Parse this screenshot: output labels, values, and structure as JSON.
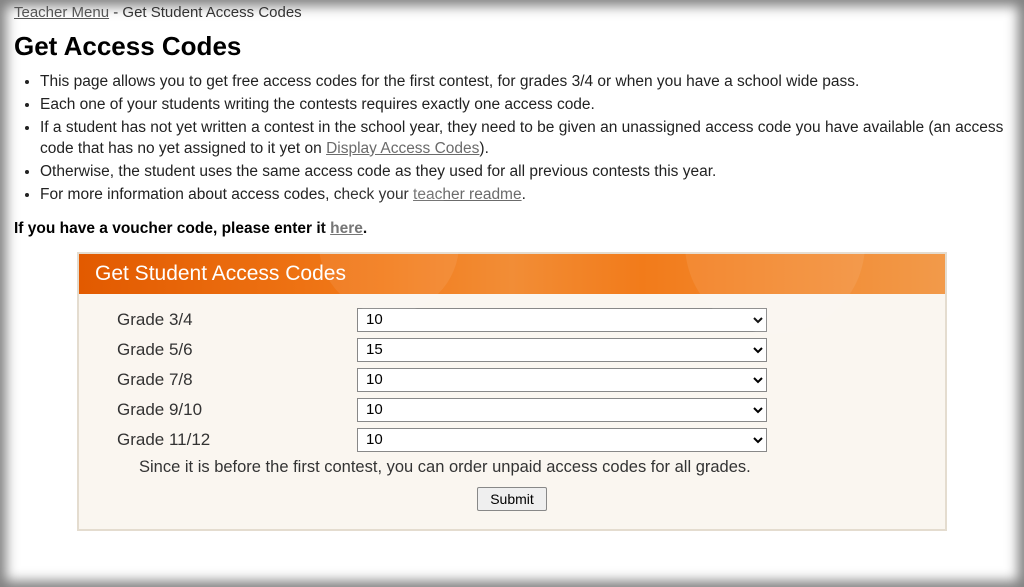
{
  "breadcrumb": {
    "link": "Teacher Menu",
    "separator": " - ",
    "current": "Get Student Access Codes"
  },
  "page_title": "Get Access Codes",
  "info_items": [
    {
      "pre": "This page allows you to get free access codes for the first contest, for grades 3/4 or when you have a school wide pass."
    },
    {
      "pre": "Each one of your students writing the contests requires exactly one access code."
    },
    {
      "pre": "If a student has not yet written a contest in the school year, they need to be given an unassigned access code you have available (an access code that has no yet assigned to it yet on ",
      "link": "Display Access Codes",
      "post": ")."
    },
    {
      "pre": "Otherwise, the student uses the same access code as they used for all previous contests this year."
    },
    {
      "pre": "For more information about access codes, check your ",
      "link": "teacher readme",
      "post": "."
    }
  ],
  "voucher": {
    "pre": "If you have a voucher code, please enter it ",
    "link": "here",
    "post": "."
  },
  "panel": {
    "title": "Get Student Access Codes",
    "rows": [
      {
        "label": "Grade 3/4",
        "value": "10"
      },
      {
        "label": "Grade 5/6",
        "value": "15"
      },
      {
        "label": "Grade 7/8",
        "value": "10"
      },
      {
        "label": "Grade 9/10",
        "value": "10"
      },
      {
        "label": "Grade 11/12",
        "value": "10"
      }
    ],
    "note": "Since it is before the first contest, you can order unpaid access codes for all grades.",
    "submit": "Submit"
  }
}
